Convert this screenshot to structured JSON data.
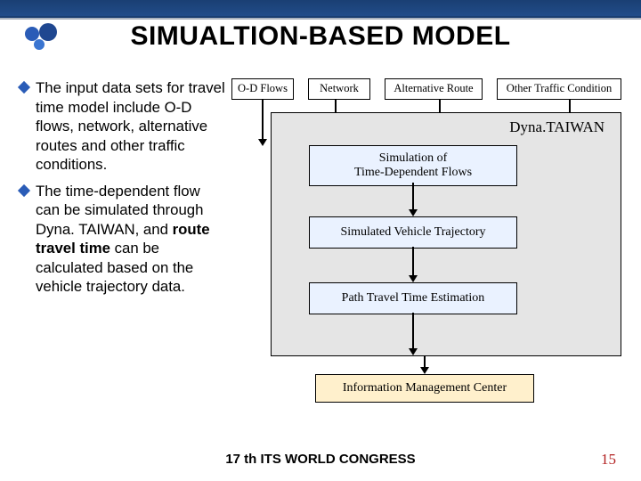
{
  "title": "SIMUALTION-BASED MODEL",
  "bullets": [
    {
      "text": "The input data sets for travel time model include O-D flows, network, alternative routes and other traffic conditions."
    },
    {
      "pre": "The time-dependent flow can be simulated through Dyna. TAIWAN, and ",
      "bold": "route travel time",
      "post": " can be calculated based on the vehicle trajectory data."
    }
  ],
  "diagram": {
    "top": [
      "O-D Flows",
      "Network",
      "Alternative Route",
      "Other Traffic Condition"
    ],
    "group_label": "Dyna.TAIWAN",
    "steps": [
      "Simulation of\nTime-Dependent Flows",
      "Simulated Vehicle Trajectory",
      "Path Travel Time Estimation"
    ],
    "bottom": "Information Management Center"
  },
  "footer": "17 th ITS WORLD CONGRESS",
  "page": "15"
}
